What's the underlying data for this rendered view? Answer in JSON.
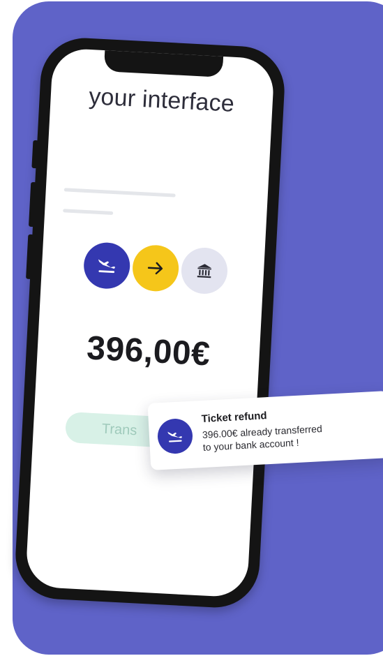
{
  "colors": {
    "background_card": "#5f63c8",
    "phone_frame": "#141414",
    "accent_blue": "#3438b0",
    "accent_yellow": "#f5c61a",
    "bank_bg": "#e3e4f0",
    "pill_bg": "#d8f1e7",
    "pill_text": "#9fcabb"
  },
  "screen": {
    "title": "your interface",
    "steps": [
      {
        "icon": "airplane-landing-icon"
      },
      {
        "icon": "arrow-right-icon"
      },
      {
        "icon": "bank-icon"
      }
    ],
    "amount": "396,00€",
    "transfer_button_label": "Trans"
  },
  "notification": {
    "icon": "airplane-landing-icon",
    "title": "Ticket refund",
    "body_line1": "396.00€ already transferred",
    "body_line2": "to your bank account !"
  }
}
